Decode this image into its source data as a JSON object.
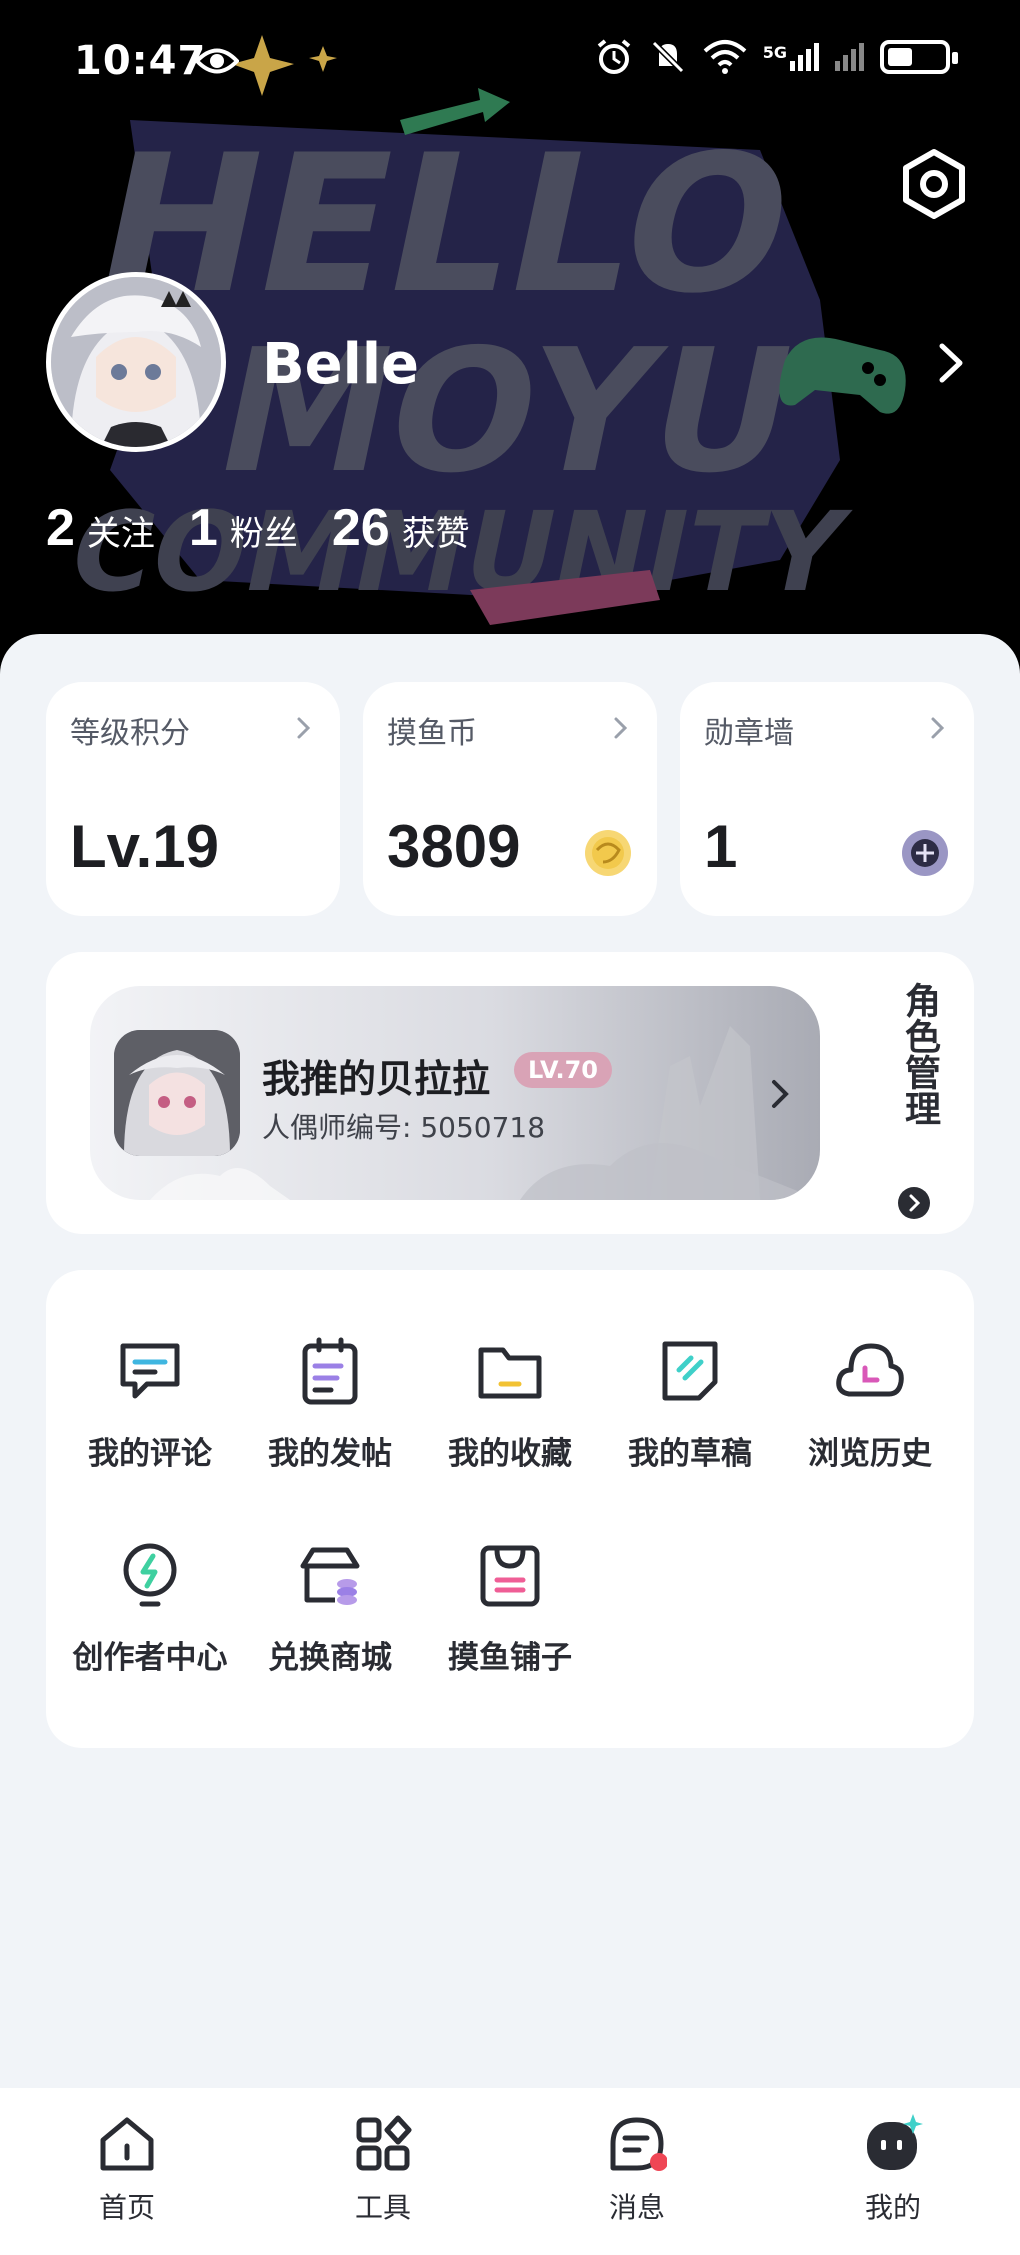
{
  "status_bar": {
    "time": "10:47",
    "network": "5G"
  },
  "header": {
    "background_text": [
      "HELLO",
      "MOYU",
      "COMMUNITY"
    ],
    "username": "Belle",
    "stats": [
      {
        "num": "2",
        "label": "关注"
      },
      {
        "num": "1",
        "label": "粉丝"
      },
      {
        "num": "26",
        "label": "获赞"
      }
    ]
  },
  "cards": [
    {
      "title": "等级积分",
      "value": "Lv.19"
    },
    {
      "title": "摸鱼币",
      "value": "3809"
    },
    {
      "title": "勋章墙",
      "value": "1"
    }
  ],
  "role": {
    "name": "我推的贝拉拉",
    "level": "LV.70",
    "id_line": "人偶师编号: 5050718",
    "manage_label": "角色管理"
  },
  "menu": [
    {
      "label": "我的评论",
      "icon": "comment-icon"
    },
    {
      "label": "我的发帖",
      "icon": "post-icon"
    },
    {
      "label": "我的收藏",
      "icon": "folder-icon"
    },
    {
      "label": "我的草稿",
      "icon": "draft-icon"
    },
    {
      "label": "浏览历史",
      "icon": "history-icon"
    },
    {
      "label": "创作者中心",
      "icon": "lightbulb-icon"
    },
    {
      "label": "兑换商城",
      "icon": "shop-icon"
    },
    {
      "label": "摸鱼铺子",
      "icon": "bag-icon"
    }
  ],
  "nav": [
    {
      "label": "首页",
      "icon": "home-icon"
    },
    {
      "label": "工具",
      "icon": "tools-icon"
    },
    {
      "label": "消息",
      "icon": "message-icon"
    },
    {
      "label": "我的",
      "icon": "profile-icon"
    }
  ],
  "colors": {
    "background": "#f1f4f8",
    "accent_cyan": "#3fd0c9",
    "accent_purple": "#9b80e6",
    "level_badge": "#d9a3b6",
    "notification_dot": "#ef4655"
  }
}
